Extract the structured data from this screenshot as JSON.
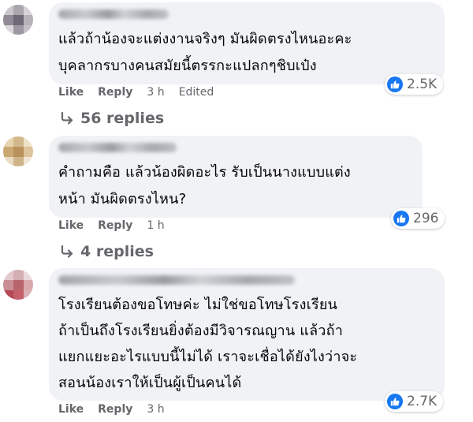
{
  "comments": [
    {
      "text": "แล้วถ้าน้องจะแต่งงานจริงๆ มันผิดตรงไหนอะคะ\nบุคลากรบางคนสมัยนี้ตรรกะแปลกๆชิบเป๋ง",
      "reaction_count": "2.5K",
      "like_label": "Like",
      "reply_label": "Reply",
      "time": "3 h",
      "edited_label": "Edited",
      "replies_label": "56 replies"
    },
    {
      "text": "คำถามคือ แล้วน้องผิดอะไร รับเป็นนางแบบแต่ง\nหน้า มันผิดตรงไหน?",
      "reaction_count": "296",
      "like_label": "Like",
      "reply_label": "Reply",
      "time": "1 h",
      "replies_label": "4 replies"
    },
    {
      "text": "โรงเรียนต้องขอโทษค่ะ ไม่ใช่ขอโทษโรงเรียน\nถ้าเป็นถึงโรงเรียนยิ่งต้องมีวิจารณญาน แล้วถ้า\nแยกแยะอะไรแบบนี้ไม่ได้ เราจะเชื่อได้ยังไงว่าจะ\nสอนน้องเราให้เป็นผู้เป็นคนได้",
      "reaction_count": "2.7K",
      "like_label": "Like",
      "reply_label": "Reply",
      "time": "3 h"
    }
  ],
  "colors": {
    "bubble": "#f0f2f5",
    "like_blue": "#1877f2",
    "meta_text": "#65676b",
    "body_text": "#050505"
  },
  "icons": {
    "reaction": "like-thumbs-up-icon",
    "reply_arrow": "reply-arrow-icon"
  }
}
